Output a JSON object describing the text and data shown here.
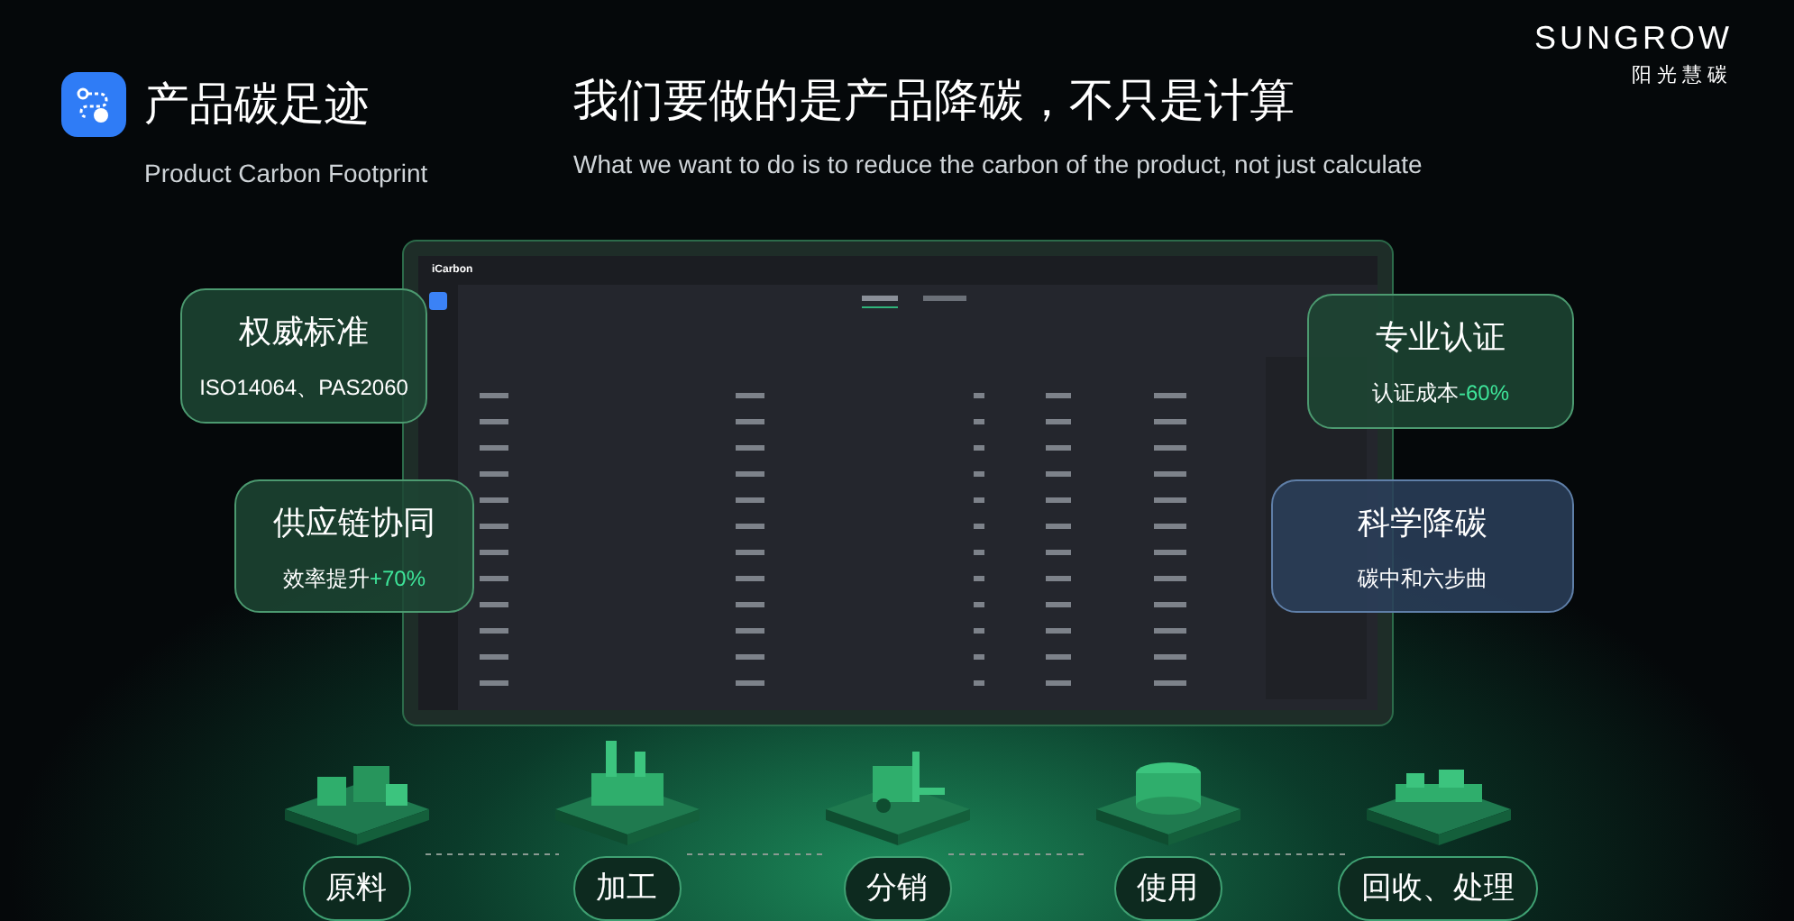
{
  "header": {
    "title": "产品碳足迹",
    "subtitle": "Product Carbon Footprint"
  },
  "slogan": {
    "title": "我们要做的是产品降碳，不只是计算",
    "subtitle": "What we want to do is to reduce the carbon of the product, not just calculate"
  },
  "brand": {
    "name": "SUNGROW",
    "tagline": "阳光慧碳"
  },
  "app": {
    "logo": "iCarbon"
  },
  "cards": [
    {
      "kind": "green",
      "title": "权威标准",
      "text": "ISO14064、PAS2060"
    },
    {
      "kind": "green",
      "title": "专业认证",
      "text": "认证成本",
      "highlight": "-60%"
    },
    {
      "kind": "green",
      "title": "供应链协同",
      "text": "效率提升",
      "highlight": "+70%"
    },
    {
      "kind": "blue",
      "title": "科学降碳",
      "text": "碳中和六步曲"
    }
  ],
  "stages": [
    {
      "kind": "blocks",
      "label": "原料"
    },
    {
      "kind": "factory",
      "label": "加工"
    },
    {
      "kind": "forklift",
      "label": "分销"
    },
    {
      "kind": "machine",
      "label": "使用"
    },
    {
      "kind": "recycle",
      "label": "回收、处理"
    }
  ]
}
